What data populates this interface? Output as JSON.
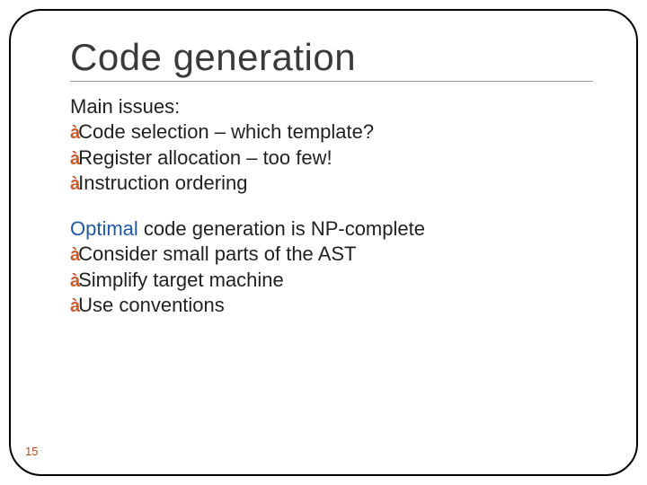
{
  "title": "Code generation",
  "section1": {
    "lead": "Main issues:",
    "items": [
      "Code selection – which template?",
      "Register allocation – too few!",
      "Instruction ordering"
    ]
  },
  "section2": {
    "lead_highlight": "Optimal",
    "lead_rest": " code generation is NP-complete",
    "items": [
      "Consider small parts of the AST",
      "Simplify target machine",
      "Use conventions"
    ]
  },
  "page_number": "15"
}
